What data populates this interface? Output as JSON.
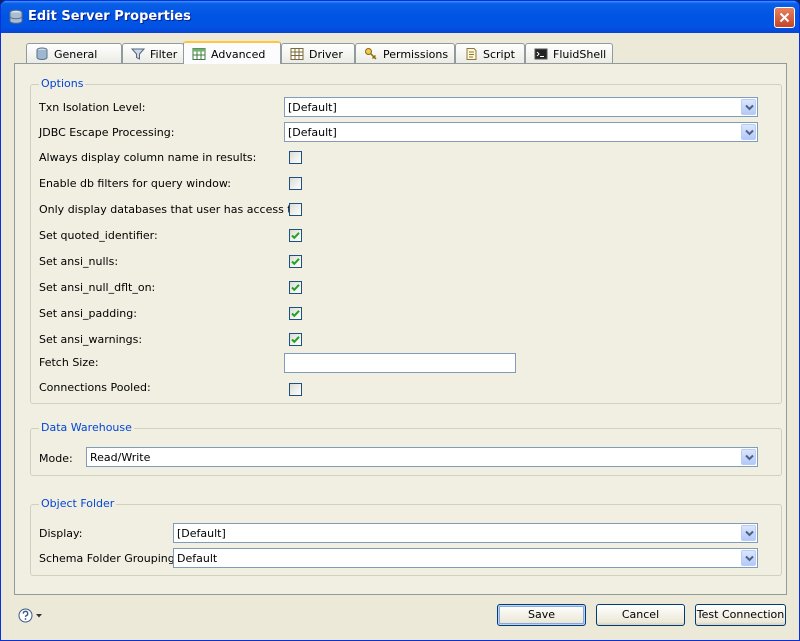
{
  "window": {
    "title": "Edit Server Properties"
  },
  "tabs": [
    {
      "label": "General",
      "icon": "server-icon"
    },
    {
      "label": "Filter",
      "icon": "filter-icon"
    },
    {
      "label": "Advanced",
      "icon": "table-icon",
      "active": true
    },
    {
      "label": "Driver",
      "icon": "driver-table-icon"
    },
    {
      "label": "Permissions",
      "icon": "key-icon"
    },
    {
      "label": "Script",
      "icon": "script-icon"
    },
    {
      "label": "FluidShell",
      "icon": "shell-icon"
    }
  ],
  "options": {
    "title": "Options",
    "txn_isolation": {
      "label": "Txn Isolation Level:",
      "value": "[Default]"
    },
    "jdbc_escape": {
      "label": "JDBC Escape Processing:",
      "value": "[Default]"
    },
    "checks": [
      {
        "label": "Always display column name in results:",
        "checked": false
      },
      {
        "label": "Enable db filters for query window:",
        "checked": false
      },
      {
        "label": "Only display databases that user has access to:",
        "checked": false
      },
      {
        "label": "Set quoted_identifier:",
        "checked": true
      },
      {
        "label": "Set ansi_nulls:",
        "checked": true
      },
      {
        "label": "Set ansi_null_dflt_on:",
        "checked": true
      },
      {
        "label": "Set ansi_padding:",
        "checked": true
      },
      {
        "label": "Set ansi_warnings:",
        "checked": true
      }
    ],
    "fetch_size": {
      "label": "Fetch Size:",
      "value": ""
    },
    "connections_pooled": {
      "label": "Connections Pooled:",
      "checked": false
    }
  },
  "data_warehouse": {
    "title": "Data Warehouse",
    "mode": {
      "label": "Mode:",
      "value": "Read/Write"
    }
  },
  "object_folder": {
    "title": "Object Folder",
    "display": {
      "label": "Display:",
      "value": "[Default]"
    },
    "schema_grouping": {
      "label": "Schema Folder Grouping:",
      "value": "Default"
    }
  },
  "buttons": {
    "save": "Save",
    "cancel": "Cancel",
    "test_connection": "Test Connection"
  },
  "colors": {
    "title_bar": "#0054e3",
    "group_title": "#0046d5",
    "check_mark": "#21a121",
    "active_tab_highlight": "#ffc83c"
  }
}
